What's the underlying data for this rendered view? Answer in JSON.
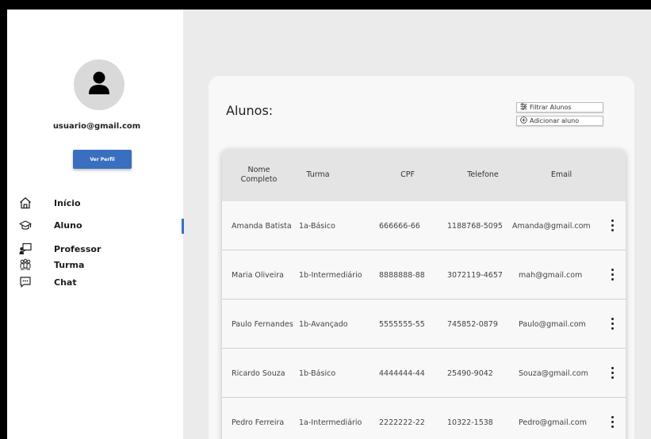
{
  "user": {
    "email": "usuario@gmail.com",
    "profile_button": "Ver Perfil"
  },
  "nav": [
    {
      "label": "Início",
      "icon": "home-icon"
    },
    {
      "label": "Aluno",
      "icon": "graduation-cap-icon",
      "active": true
    },
    {
      "label": "Professor",
      "icon": "teacher-board-icon"
    },
    {
      "label": "Turma",
      "icon": "group-icon"
    },
    {
      "label": "Chat",
      "icon": "chat-bubble-icon"
    }
  ],
  "main": {
    "title": "Alunos:",
    "filter_button": "Filtrar Alunos",
    "add_button": "Adicionar aluno",
    "columns": [
      "Nome Completo",
      "Turma",
      "CPF",
      "Telefone",
      "Email"
    ],
    "rows": [
      [
        "Amanda Batista",
        "1a-Básico",
        "666666-66",
        "1188768-5095",
        "Amanda@gmail.com"
      ],
      [
        "Maria Oliveira",
        "1b-Intermediário",
        "8888888-88",
        "3072119-4657",
        "mah@gmail.com"
      ],
      [
        "Paulo Fernandes",
        "1b-Avançado",
        "5555555-55",
        "745852-0879",
        "Paulo@gmail.com"
      ],
      [
        "Ricardo Souza",
        "1b-Básico",
        "4444444-44",
        "25490-9042",
        "Souza@gmail.com"
      ],
      [
        "Pedro Ferreira",
        "1a-Intermediário",
        "2222222-22",
        "10322-1538",
        "Pedro@gmail.com"
      ]
    ]
  },
  "colors": {
    "accent": "#3a6fc0",
    "background": "#ebebeb",
    "header_row": "#e4e4e4"
  }
}
